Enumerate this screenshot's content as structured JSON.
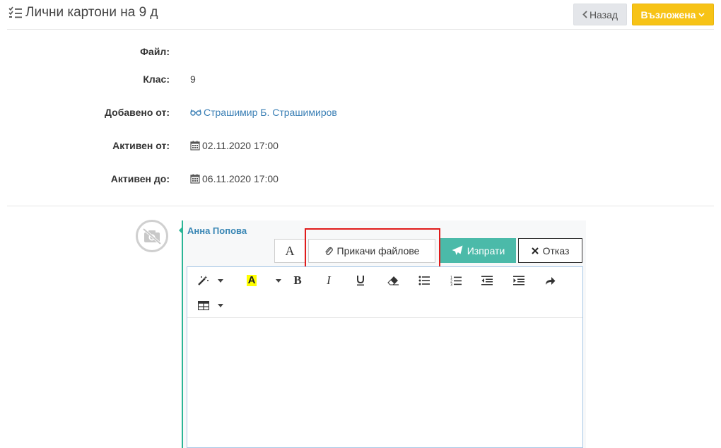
{
  "header": {
    "title": "Лични картони на 9 д",
    "title_icon": "list-check-icon",
    "back_label": "Назад",
    "status_label": "Възложена",
    "status_color": "#f7c316"
  },
  "details": {
    "file_label": "Файл:",
    "file_value": "",
    "class_label": "Клас:",
    "class_value": "9",
    "added_by_label": "Добавено от:",
    "added_by_value": "Страшимир Б. Страшимиров",
    "active_from_label": "Активен от:",
    "active_from_value": "02.11.2020 17:00",
    "active_to_label": "Активен до:",
    "active_to_value": "06.11.2020 17:00"
  },
  "comment": {
    "author": "Анна Попова",
    "font_button_label": "A",
    "attach_label": "Прикачи файлове",
    "send_label": "Изпрати",
    "cancel_label": "Отказ",
    "accent_color": "#4bbaa9",
    "highlight_color": "#e01b1b"
  },
  "editor_toolbar": {
    "buttons": [
      "magic-wand-icon",
      "highlight-color-icon",
      "bold-icon",
      "italic-icon",
      "underline-icon",
      "eraser-icon",
      "unordered-list-icon",
      "ordered-list-icon",
      "outdent-icon",
      "indent-icon",
      "redo-icon",
      "table-icon"
    ]
  }
}
